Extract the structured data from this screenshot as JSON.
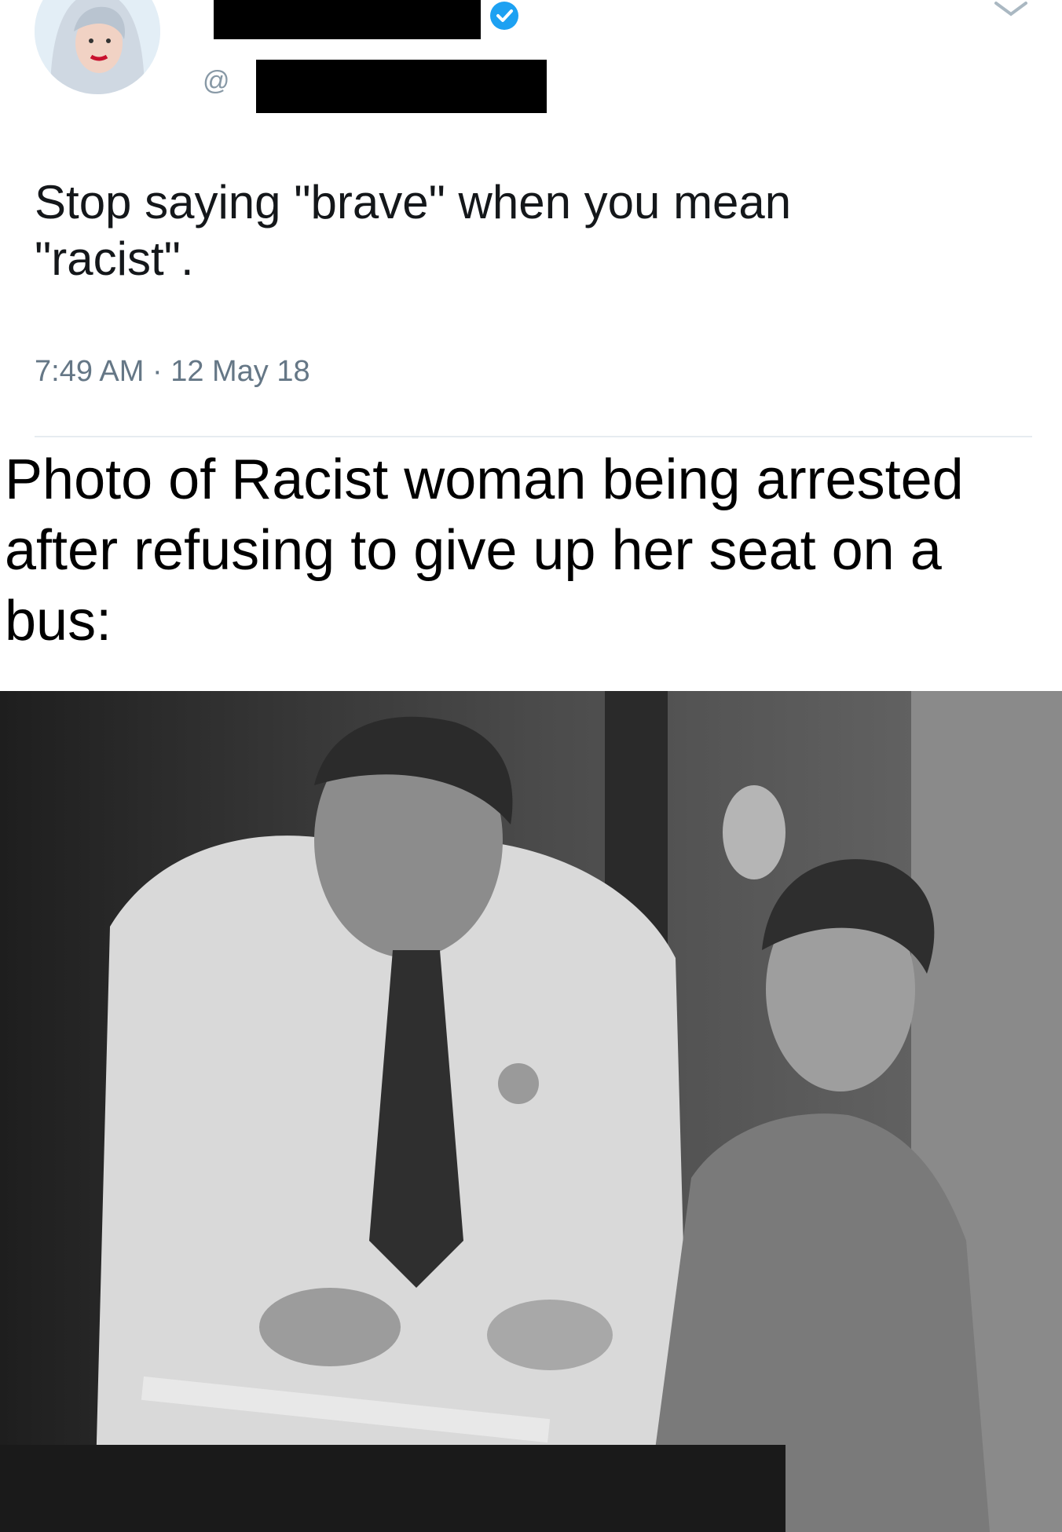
{
  "tweet": {
    "avatar_icon": "user-avatar-photo",
    "verified_icon": "verified-check-icon",
    "handle_prefix": "@",
    "menu_icon": "chevron-down-icon",
    "text": "Stop saying \"brave\" when you mean \"racist\".",
    "timestamp": "7:49 AM · 12 May 18"
  },
  "caption": {
    "text": "Photo of Racist woman being arrested after refusing to give up her seat on a bus:"
  },
  "photo": {
    "subject": "black-and-white photograph"
  },
  "colors": {
    "verified": "#1da1f2",
    "timestamp": "#657786",
    "text": "#14171a",
    "redaction": "#000000"
  }
}
